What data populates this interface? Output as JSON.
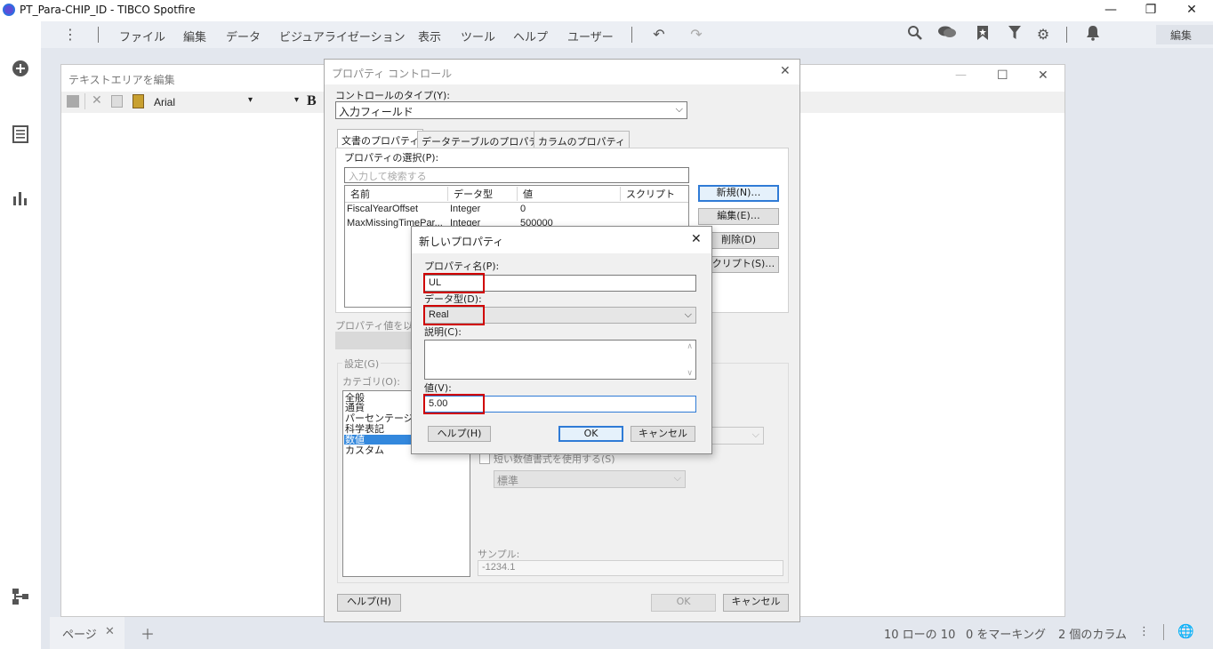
{
  "app": {
    "title": "PT_Para-CHIP_ID - TIBCO Spotfire"
  },
  "window_controls": {
    "minimize": "—",
    "restore": "❐",
    "close": "✕"
  },
  "menu": {
    "items": [
      "ファイル",
      "編集",
      "データ",
      "ビジュアライゼーション",
      "表示",
      "ツール",
      "ヘルプ",
      "ユーザー"
    ],
    "edit_mode": "編集"
  },
  "text_editor": {
    "title": "テキストエリアを編集",
    "font": "Arial",
    "bold": "B"
  },
  "status": {
    "page_tab": "ページ",
    "rows": "10 ローの 10",
    "marking": "0 をマーキング",
    "columns": "2 個のカラム"
  },
  "property_control": {
    "title": "プロパティ コントロール",
    "control_type_label": "コントロールのタイプ(Y):",
    "control_type_value": "入力フィールド",
    "tabs": [
      "文書のプロパティ",
      "データテーブルのプロパティ",
      "カラムのプロパティ"
    ],
    "select_property_label": "プロパティの選択(P):",
    "search_placeholder": "入力して検索する",
    "columns": [
      "名前",
      "データ型",
      "値",
      "スクリプト"
    ],
    "rows": [
      {
        "name": "FiscalYearOffset",
        "type": "Integer",
        "value": "0"
      },
      {
        "name": "MaxMissingTimePar...",
        "type": "Integer",
        "value": "500000"
      }
    ],
    "buttons": {
      "new": "新規(N)…",
      "edit": "編集(E)…",
      "delete": "削除(D)",
      "script": "スクリプト(S)…"
    },
    "value_source_label": "プロパティ値を以下",
    "settings_label": "設定(G)",
    "category_label": "カテゴリ(O):",
    "categories": [
      "全般",
      "通貨",
      "パーセンテージ",
      "科学表記",
      "数値",
      "カスタム"
    ],
    "short_number_label": "短い数値書式を使用する(S)",
    "short_number_value": "標準",
    "sample_label": "サンプル:",
    "sample_value": "-1234.1",
    "help": "ヘルプ(H)",
    "ok": "OK",
    "cancel": "キャンセル"
  },
  "new_property": {
    "title": "新しいプロパティ",
    "name_label": "プロパティ名(P):",
    "name_value": "UL",
    "type_label": "データ型(D):",
    "type_value": "Real",
    "description_label": "説明(C):",
    "value_label": "値(V):",
    "value_value": "5.00",
    "help": "ヘルプ(H)",
    "ok": "OK",
    "cancel": "キャンセル"
  }
}
